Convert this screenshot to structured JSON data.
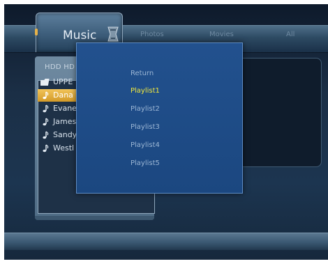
{
  "tabs": {
    "music": "Music",
    "photos": "Photos",
    "movies": "Movies",
    "all": "All"
  },
  "browser": {
    "path": "HDD HD",
    "rows": [
      {
        "icon": "folder-icon",
        "label": "UPPE"
      },
      {
        "icon": "music-note-icon",
        "label": "Dana",
        "selected": true
      },
      {
        "icon": "music-note-icon",
        "label": "Evane"
      },
      {
        "icon": "music-note-icon",
        "label": "James"
      },
      {
        "icon": "music-note-icon",
        "label": "Sandy"
      },
      {
        "icon": "music-note-icon",
        "label": "Westl"
      }
    ]
  },
  "popup": {
    "items": [
      {
        "label": "Return"
      },
      {
        "label": "Playlist1",
        "highlighted": true
      },
      {
        "label": "Playlist2"
      },
      {
        "label": "Playlist3"
      },
      {
        "label": "Playlist4"
      },
      {
        "label": "Playlist5"
      }
    ]
  },
  "colors": {
    "highlight_row": "#d9a22f",
    "highlight_text": "#f3e93c",
    "popup_bg": "#1f4c88",
    "topbar": "#3a5a77"
  }
}
